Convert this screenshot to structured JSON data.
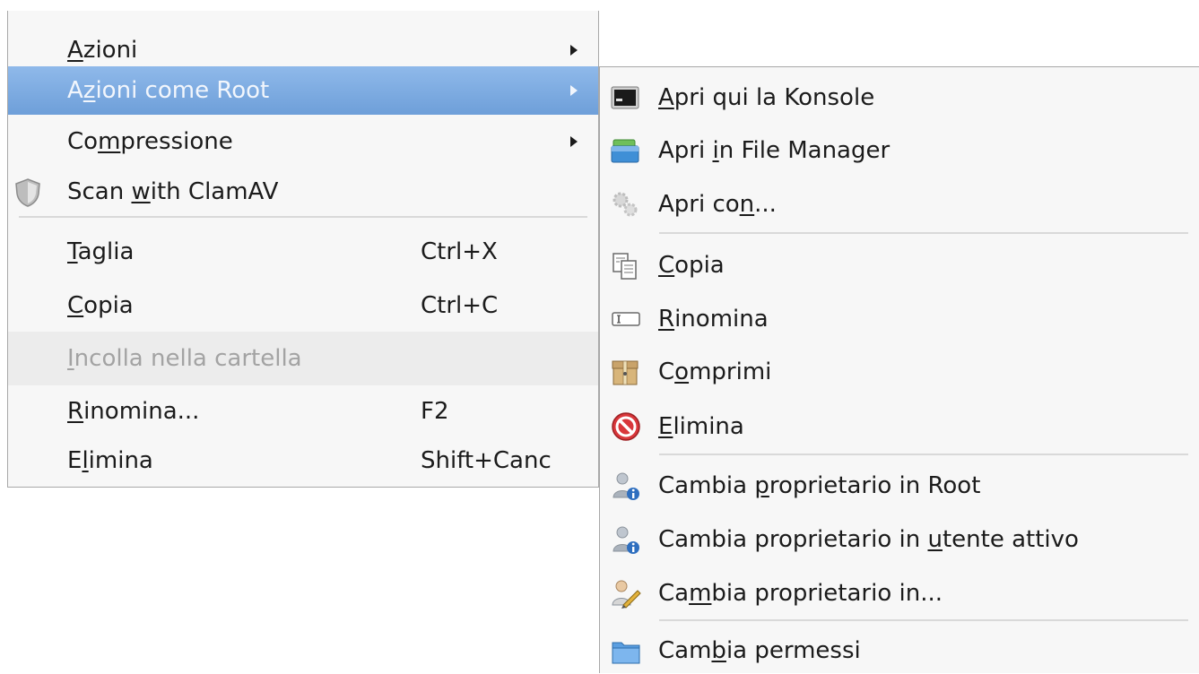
{
  "main_menu": {
    "items": [
      {
        "pre": "",
        "u": "A",
        "post": "zioni",
        "shortcut": "",
        "submenu": true
      },
      {
        "pre": "A",
        "u": "z",
        "post": "ioni come Root",
        "shortcut": "",
        "submenu": true
      },
      {
        "pre": "Co",
        "u": "m",
        "post": "pressione",
        "shortcut": "",
        "submenu": true
      },
      {
        "pre": "Scan ",
        "u": "w",
        "post": "ith ClamAV",
        "shortcut": "",
        "submenu": false
      },
      {
        "pre": "",
        "u": "T",
        "post": "aglia",
        "shortcut": "Ctrl+X",
        "submenu": false
      },
      {
        "pre": "",
        "u": "C",
        "post": "opia",
        "shortcut": "Ctrl+C",
        "submenu": false
      },
      {
        "pre": "",
        "u": "I",
        "post": "ncolla nella cartella",
        "shortcut": "",
        "submenu": false
      },
      {
        "pre": "",
        "u": "R",
        "post": "inomina...",
        "shortcut": "F2",
        "submenu": false
      },
      {
        "pre": "E",
        "u": "l",
        "post": "imina",
        "shortcut": "Shift+Canc",
        "submenu": false
      }
    ]
  },
  "sub_menu": {
    "items": [
      {
        "pre": "",
        "u": "A",
        "post": "pri qui la Konsole",
        "icon": "terminal-icon"
      },
      {
        "pre": "Apri ",
        "u": "i",
        "post": "n File Manager",
        "icon": "file-manager-icon"
      },
      {
        "pre": "Apri co",
        "u": "n",
        "post": "...",
        "icon": "gears-icon"
      },
      {
        "pre": "",
        "u": "C",
        "post": "opia",
        "icon": "copy-icon"
      },
      {
        "pre": "",
        "u": "R",
        "post": "inomina",
        "icon": "rename-icon"
      },
      {
        "pre": "C",
        "u": "o",
        "post": "mprimi",
        "icon": "archive-box-icon"
      },
      {
        "pre": "",
        "u": "E",
        "post": "limina",
        "icon": "delete-icon"
      },
      {
        "pre": "Cambia ",
        "u": "p",
        "post": "roprietario in Root",
        "icon": "user-info-icon"
      },
      {
        "pre": "Cambia proprietario in ",
        "u": "u",
        "post": "tente attivo",
        "icon": "user-info-icon"
      },
      {
        "pre": "Ca",
        "u": "m",
        "post": "bia proprietario in...",
        "icon": "user-edit-icon"
      },
      {
        "pre": "Cam",
        "u": "b",
        "post": "ia permessi",
        "icon": "folder-icon"
      }
    ]
  }
}
